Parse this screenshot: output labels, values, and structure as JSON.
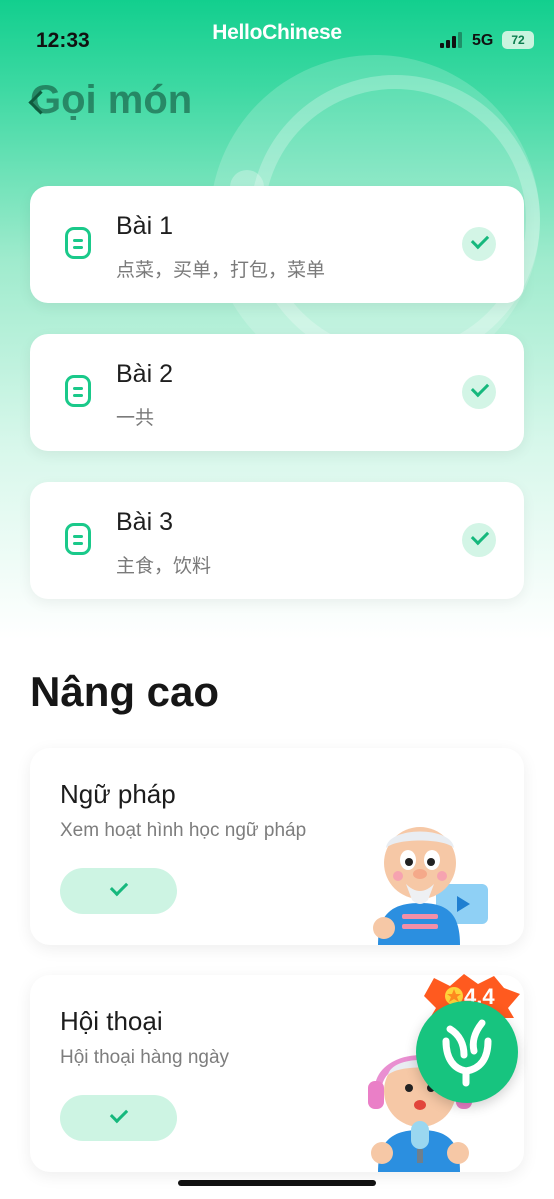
{
  "status_bar": {
    "time": "12:33",
    "network": "5G",
    "battery": "72"
  },
  "app": {
    "brand": "HelloChinese"
  },
  "header": {
    "title": "Gọi món"
  },
  "lessons": [
    {
      "title": "Bài 1",
      "subtitle": "点菜，买单，打包，菜单",
      "completed": true
    },
    {
      "title": "Bài 2",
      "subtitle": "一共",
      "completed": true
    },
    {
      "title": "Bài 3",
      "subtitle": "主食，饮料",
      "completed": true
    }
  ],
  "advanced": {
    "section_title": "Nâng cao",
    "cards": [
      {
        "title": "Ngữ pháp",
        "subtitle": "Xem hoạt hình học ngữ pháp",
        "completed": true,
        "illustration": "teacher-with-video-icon"
      },
      {
        "title": "Hội thoại",
        "subtitle": "Hội thoại hàng ngày",
        "completed": true,
        "illustration": "teacher-with-headphones-microphone-icon"
      }
    ]
  },
  "floating": {
    "rating": "4.4",
    "icon": "sprout-icon"
  },
  "colors": {
    "accent": "#17c47f",
    "check_bg": "#d3f5e6",
    "header_green": "#12cf8e"
  }
}
